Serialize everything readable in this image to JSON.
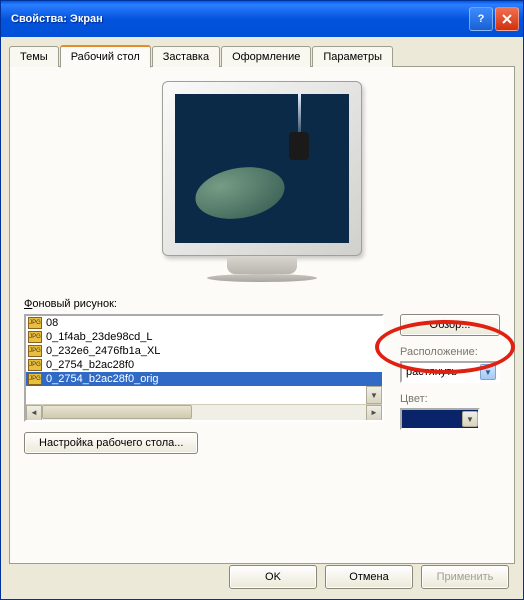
{
  "title": "Свойства: Экран",
  "titlebar_help": "?",
  "titlebar_close": "X",
  "tabs": [
    "Темы",
    "Рабочий стол",
    "Заставка",
    "Оформление",
    "Параметры"
  ],
  "active_tab": 1,
  "bg_label_pre": "Ф",
  "bg_label_rest": "оновый рисунок:",
  "list_items": [
    "08",
    "0_1f4ab_23de98cd_L",
    "0_232e6_2476fb1a_XL",
    "0_2754_b2ac28f0",
    "0_2754_b2ac28f0_orig"
  ],
  "selected_index": 4,
  "browse_label": "Обзор...",
  "position_label": "Расположение:",
  "position_value": "растянуть",
  "color_label": "Цвет:",
  "color_value": "#0a246a",
  "customize_pre": "Н",
  "customize_rest": "астройка рабочего стола...",
  "buttons": {
    "ok": "OK",
    "cancel": "Отмена",
    "apply": "Применить"
  }
}
